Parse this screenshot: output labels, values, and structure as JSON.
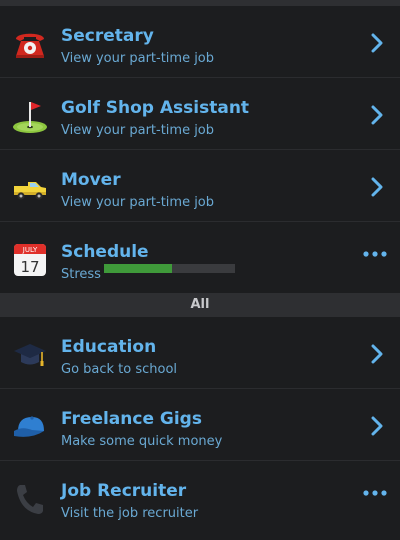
{
  "part_time_jobs": [
    {
      "title": "Secretary",
      "subtitle": "View your part-time job",
      "icon": "telephone-icon",
      "action": "chevron"
    },
    {
      "title": "Golf Shop Assistant",
      "subtitle": "View your part-time job",
      "icon": "golf-flag-icon",
      "action": "chevron"
    },
    {
      "title": "Mover",
      "subtitle": "View your part-time job",
      "icon": "pickup-truck-icon",
      "action": "chevron"
    }
  ],
  "schedule": {
    "title": "Schedule",
    "stress_label": "Stress",
    "stress_level": 0.52,
    "calendar_month": "JULY",
    "calendar_day": "17",
    "icon": "calendar-icon"
  },
  "section": {
    "label": "All"
  },
  "all_items": [
    {
      "title": "Education",
      "subtitle": "Go back to school",
      "icon": "graduation-cap-icon",
      "action": "chevron"
    },
    {
      "title": "Freelance Gigs",
      "subtitle": "Make some quick money",
      "icon": "baseball-cap-icon",
      "action": "chevron"
    },
    {
      "title": "Job Recruiter",
      "subtitle": "Visit the job recruiter",
      "icon": "phone-receiver-icon",
      "action": "more"
    }
  ],
  "colors": {
    "background": "#1c1d1f",
    "title_blue": "#63b4ec",
    "subtitle_blue": "#6aa9d3",
    "stress_green": "#3f9a3a",
    "section_bg": "#2e2f32"
  }
}
